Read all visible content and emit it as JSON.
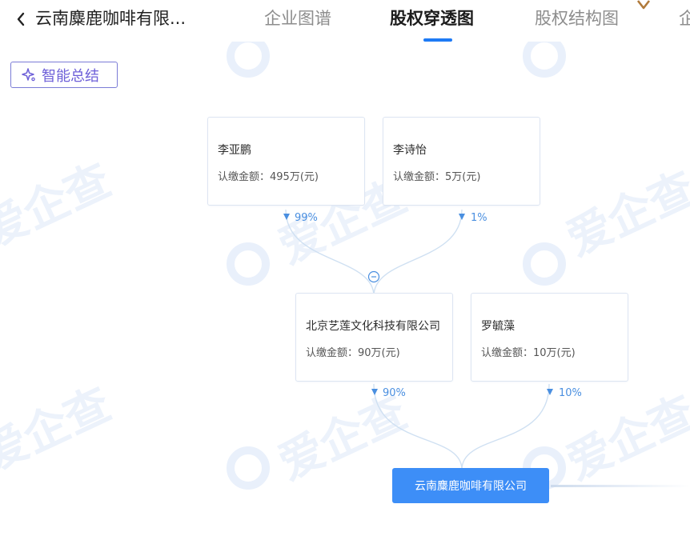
{
  "header": {
    "company_title": "云南麋鹿咖啡有限...",
    "tabs": [
      {
        "label": "企业图谱",
        "active": false
      },
      {
        "label": "股权穿透图",
        "active": true
      },
      {
        "label": "股权结构图",
        "active": false
      },
      {
        "label": "企",
        "active": false
      }
    ]
  },
  "watermark": {
    "text": "爱企查"
  },
  "summary_button": {
    "label": "智能总结"
  },
  "shareholders_top": [
    {
      "name": "李亚鹏",
      "amount": "认缴金额：495万(元)",
      "percent": "99%"
    },
    {
      "name": "李诗怡",
      "amount": "认缴金额：5万(元)",
      "percent": "1%"
    }
  ],
  "shareholders_mid": [
    {
      "name": "北京艺莲文化科技有限公司",
      "amount": "认缴金额：90万(元)",
      "percent": "90%"
    },
    {
      "name": "罗毓藻",
      "amount": "认缴金额：10万(元)",
      "percent": "10%"
    }
  ],
  "target_company": {
    "name": "云南麋鹿咖啡有限公司"
  },
  "colors": {
    "accent": "#1e7bf5",
    "target_bg": "#3d8ef7",
    "summary_border": "#7b7cd6",
    "link_line": "#cfe0f2",
    "percent_text": "#4a8fe0"
  },
  "icons": [
    "chevron-left-icon",
    "vip-diamond-icon",
    "sparkle-icon",
    "collapse-minus-icon",
    "arrow-down-icon"
  ]
}
